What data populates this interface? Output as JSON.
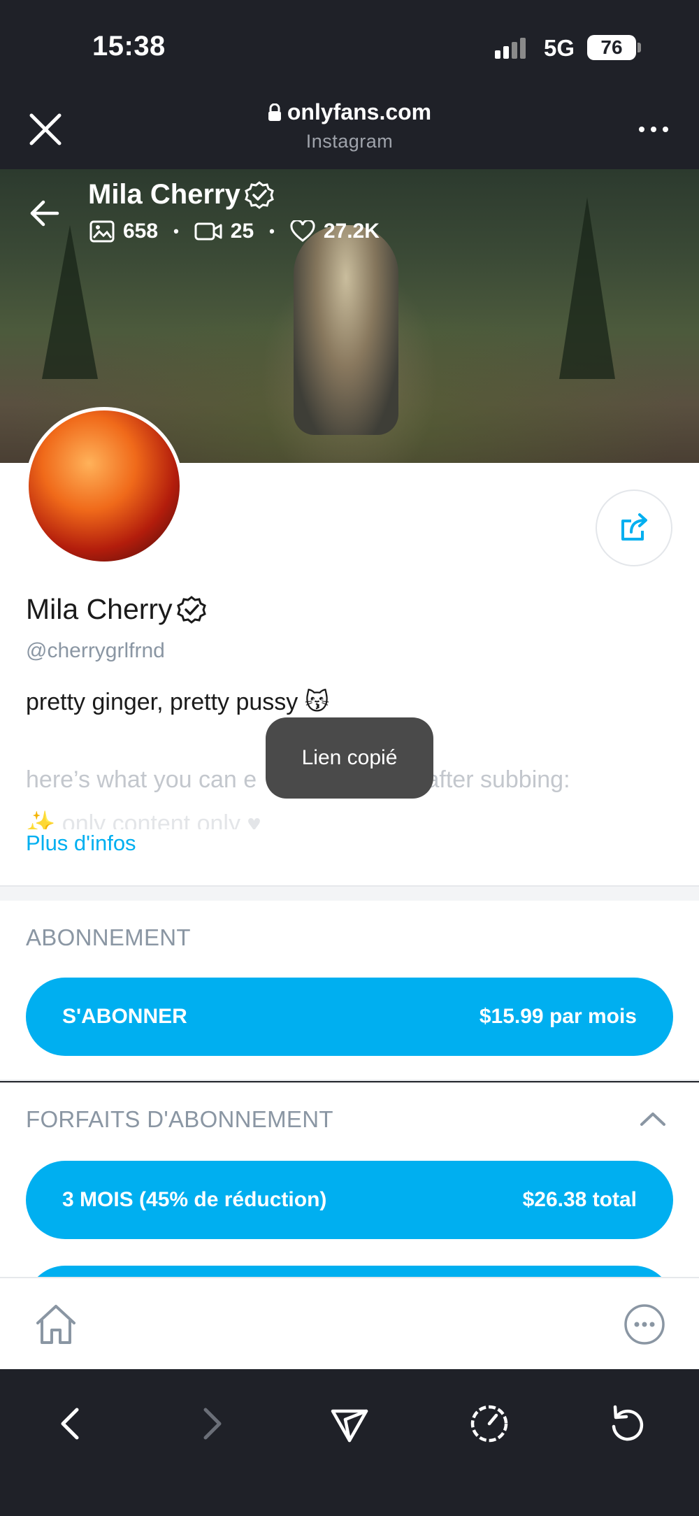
{
  "status_bar": {
    "time": "15:38",
    "network": "5G",
    "battery": "76"
  },
  "browser": {
    "url": "onlyfans.com",
    "source": "Instagram"
  },
  "cover": {
    "name": "Mila Cherry",
    "photos": "658",
    "videos": "25",
    "likes": "27.2K"
  },
  "profile": {
    "name": "Mila Cherry",
    "handle": "@cherrygrlfrnd",
    "bio_line1": "pretty ginger, pretty pussy 😽",
    "bio_line2": "here’s what you can e",
    "bio_line2_end": "e after subbing:",
    "bio_line3": "✨ only content only ♥",
    "more_info": "Plus d'infos"
  },
  "toast": "Lien copié",
  "subscription": {
    "title": "ABONNEMENT",
    "button_label": "S'ABONNER",
    "button_price": "$15.99 par mois"
  },
  "bundles": {
    "title": "FORFAITS D'ABONNEMENT",
    "items": [
      {
        "label": "3 MOIS (45% de réduction)",
        "price": "$26.38 total"
      }
    ]
  },
  "colors": {
    "accent": "#00aff0",
    "dark": "#1f2128",
    "muted": "#8a96a3"
  }
}
